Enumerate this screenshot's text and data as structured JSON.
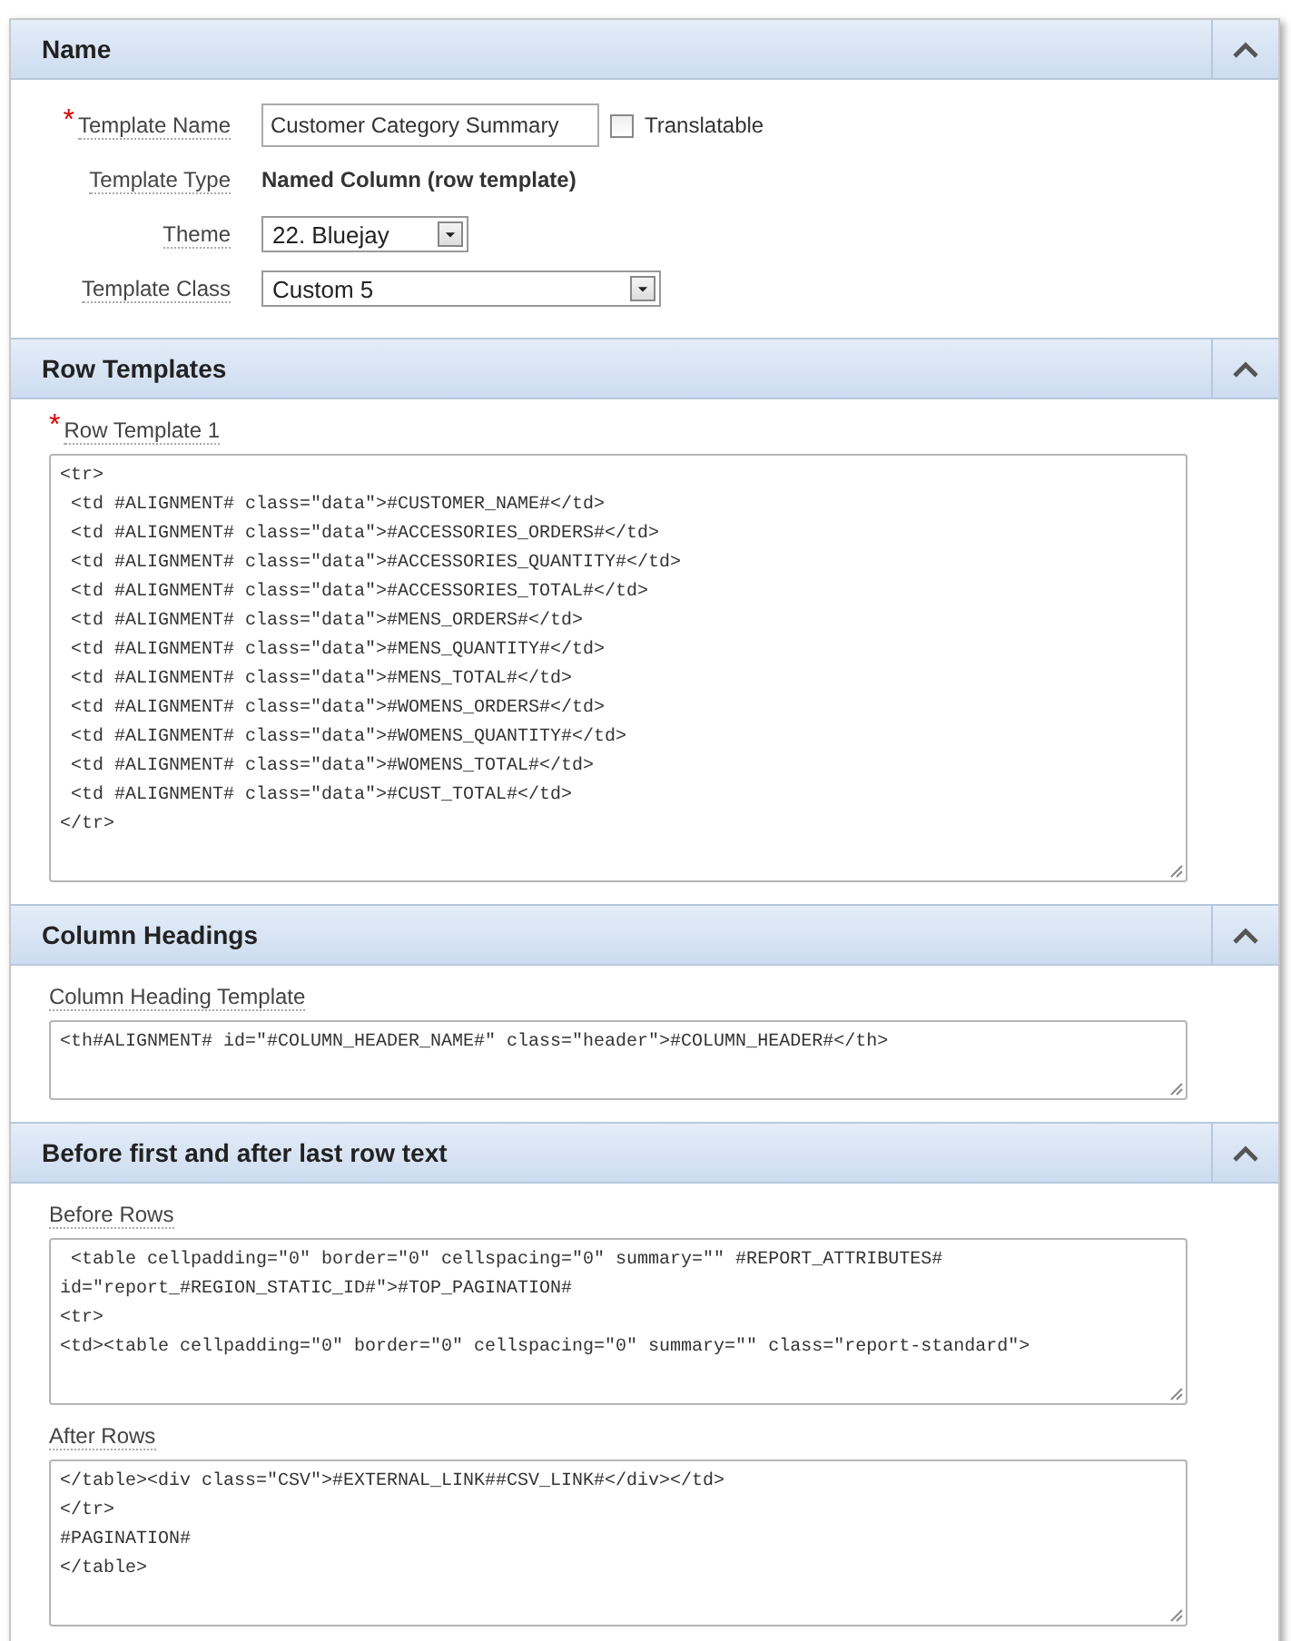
{
  "sections": [
    {
      "title": "Name",
      "expanded": true,
      "fields": [
        {
          "kind": "text",
          "label": "Template Name",
          "required_mark": "*",
          "value": "Customer Category Summary",
          "checkbox": {
            "label": "Translatable",
            "checked": false
          }
        },
        {
          "kind": "display",
          "label": "Template Type",
          "value": "Named Column (row template)"
        },
        {
          "kind": "select",
          "label": "Theme",
          "value": "22. Bluejay"
        },
        {
          "kind": "select",
          "label": "Template Class",
          "value": "Custom 5"
        }
      ]
    },
    {
      "title": "Row Templates",
      "expanded": true,
      "fields": [
        {
          "kind": "code",
          "label": "Row Template 1",
          "required_mark": "*",
          "value": "<tr>\n <td #ALIGNMENT# class=\"data\">#CUSTOMER_NAME#</td>\n <td #ALIGNMENT# class=\"data\">#ACCESSORIES_ORDERS#</td>\n <td #ALIGNMENT# class=\"data\">#ACCESSORIES_QUANTITY#</td>\n <td #ALIGNMENT# class=\"data\">#ACCESSORIES_TOTAL#</td>\n <td #ALIGNMENT# class=\"data\">#MENS_ORDERS#</td>\n <td #ALIGNMENT# class=\"data\">#MENS_QUANTITY#</td>\n <td #ALIGNMENT# class=\"data\">#MENS_TOTAL#</td>\n <td #ALIGNMENT# class=\"data\">#WOMENS_ORDERS#</td>\n <td #ALIGNMENT# class=\"data\">#WOMENS_QUANTITY#</td>\n <td #ALIGNMENT# class=\"data\">#WOMENS_TOTAL#</td>\n <td #ALIGNMENT# class=\"data\">#CUST_TOTAL#</td>\n</tr>"
        }
      ]
    },
    {
      "title": "Column Headings",
      "expanded": true,
      "fields": [
        {
          "kind": "code",
          "label": "Column Heading Template",
          "value": "<th#ALIGNMENT# id=\"#COLUMN_HEADER_NAME#\" class=\"header\">#COLUMN_HEADER#</th>"
        }
      ]
    },
    {
      "title": "Before first and after last row text",
      "expanded": true,
      "fields": [
        {
          "kind": "code",
          "label": "Before Rows",
          "value": " <table cellpadding=\"0\" border=\"0\" cellspacing=\"0\" summary=\"\" #REPORT_ATTRIBUTES#\nid=\"report_#REGION_STATIC_ID#\">#TOP_PAGINATION#\n<tr>\n<td><table cellpadding=\"0\" border=\"0\" cellspacing=\"0\" summary=\"\" class=\"report-standard\">"
        },
        {
          "kind": "code",
          "label": "After Rows",
          "value": "</table><div class=\"CSV\">#EXTERNAL_LINK##CSV_LINK#</div></td>\n</tr>\n#PAGINATION#\n</table>"
        }
      ]
    }
  ]
}
